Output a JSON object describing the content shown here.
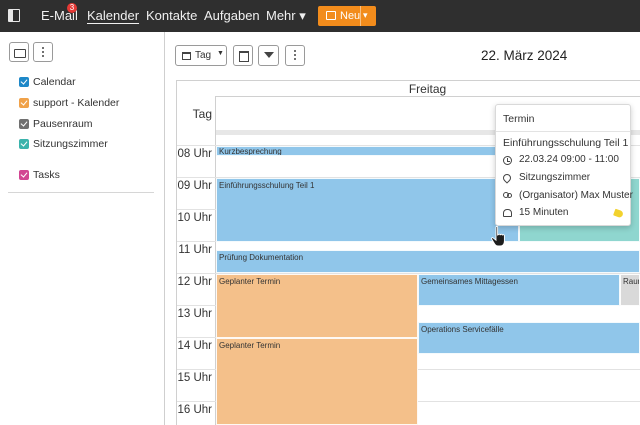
{
  "topbar": {
    "nav": [
      {
        "label": "E-Mail",
        "badge": "3"
      },
      {
        "label": "Kalender",
        "active": true
      },
      {
        "label": "Kontakte"
      },
      {
        "label": "Aufgaben"
      },
      {
        "label": "Mehr ▾"
      }
    ],
    "new_button": {
      "label": "Neu",
      "color": "#f28c1c"
    }
  },
  "sidebar": {
    "calendars": [
      {
        "label": "Calendar",
        "color": "#1e88c8"
      },
      {
        "label": "support - Kalender",
        "color": "#f0a24a"
      },
      {
        "label": "Pausenraum",
        "color": "#707070"
      },
      {
        "label": "Sitzungszimmer",
        "color": "#3bb3ac"
      }
    ],
    "tasks": {
      "label": "Tasks",
      "color": "#d24592"
    }
  },
  "toolbar": {
    "view_label": "Tag"
  },
  "header": {
    "date_title": "22. März 2024",
    "day_name": "Freitag",
    "allday_label": "Tag"
  },
  "hours": [
    "08 Uhr",
    "09 Uhr",
    "10 Uhr",
    "11 Uhr",
    "12 Uhr",
    "13 Uhr",
    "14 Uhr",
    "15 Uhr",
    "16 Uhr"
  ],
  "events": {
    "kurzbesprechung": "Kurzbesprechung",
    "einfuehrung": "Einführungsschulung Teil 1",
    "pruefung": "Prüfung Dokumentation",
    "geplant1": "Geplanter Termin",
    "mittagessen": "Gemeinsames Mittagessen",
    "raum": "Raum",
    "operations": "Operations Servicefälle",
    "geplant2": "Geplanter Termin"
  },
  "popover": {
    "heading": "Termin",
    "title": "Einführungsschulung Teil 1",
    "time": "22.03.24 09:00 - 11:00",
    "location": "Sitzungszimmer",
    "organizer": "(Organisator) Max Muster",
    "reminder": "15 Minuten"
  }
}
